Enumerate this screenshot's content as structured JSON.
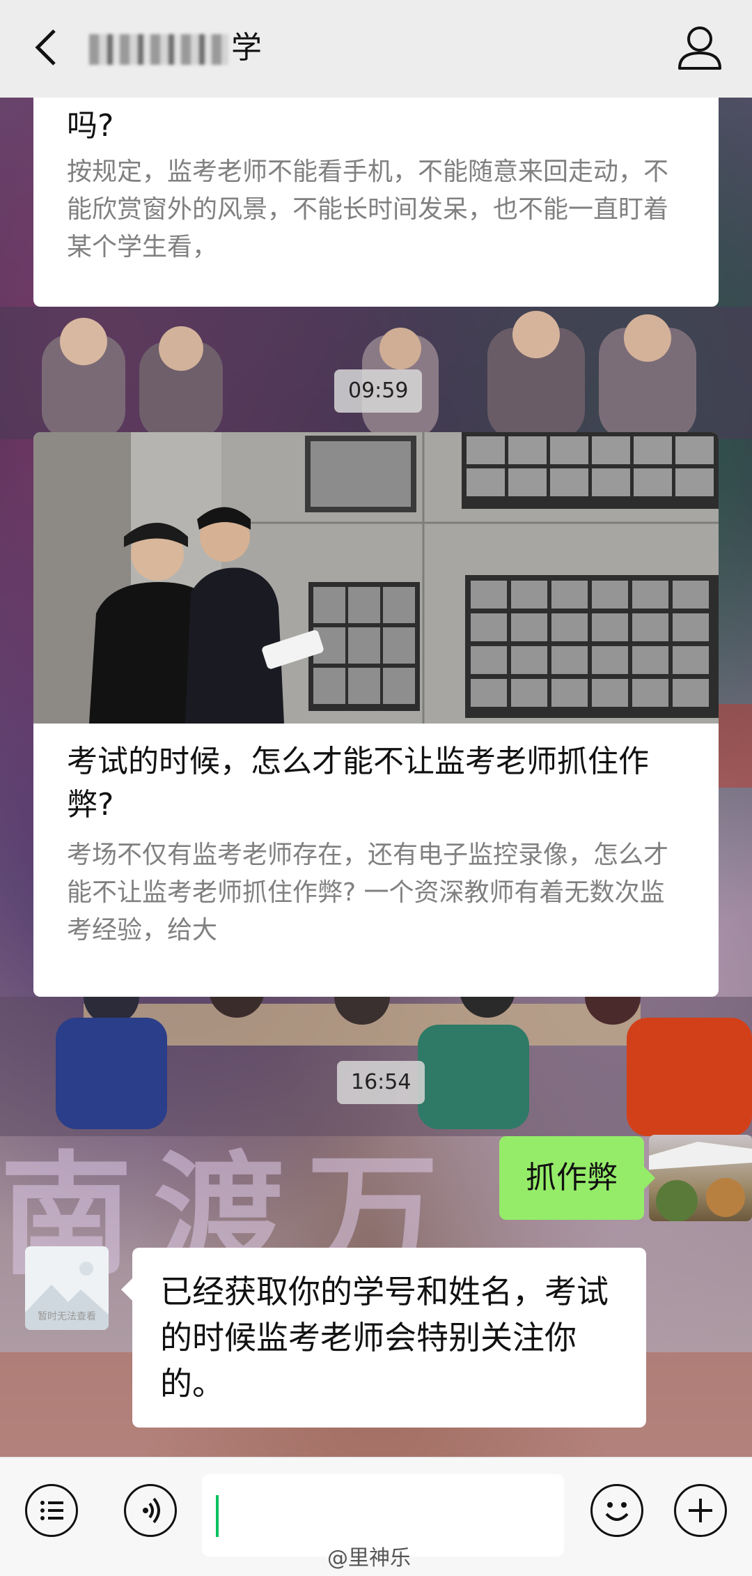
{
  "header": {
    "title_suffix": "学",
    "back_icon": "chevron-left-icon",
    "profile_icon": "person-icon"
  },
  "card1": {
    "title": "吗?",
    "desc": "按规定，监考老师不能看手机，不能随意来回走动，不能欣赏窗外的风景，不能长时间发呆，也不能一直盯着某个学生看，"
  },
  "timestamp1": "09:59",
  "card2": {
    "title": "考试的时候，怎么才能不让监考老师抓住作弊?",
    "desc": "考场不仅有监考老师存在，还有电子监控录像，怎么才能不让监考老师抓住作弊? 一个资深教师有着无数次监考经验，给大"
  },
  "timestamp2": "16:54",
  "background_text": "南渡万",
  "outgoing_message": "抓作弊",
  "incoming": {
    "avatar_caption": "暂时无法查看",
    "message": "已经获取你的学号和姓名，考试的时候监考老师会特别关注你的。"
  },
  "bottom": {
    "menu_icon": "list-menu-icon",
    "voice_icon": "voice-icon",
    "emoji_icon": "smiley-icon",
    "plus_icon": "plus-icon",
    "watermark": "@里神乐"
  },
  "colors": {
    "bubble_green": "#95ec69",
    "cursor": "#07c160",
    "bar_bg": "#ededed"
  }
}
